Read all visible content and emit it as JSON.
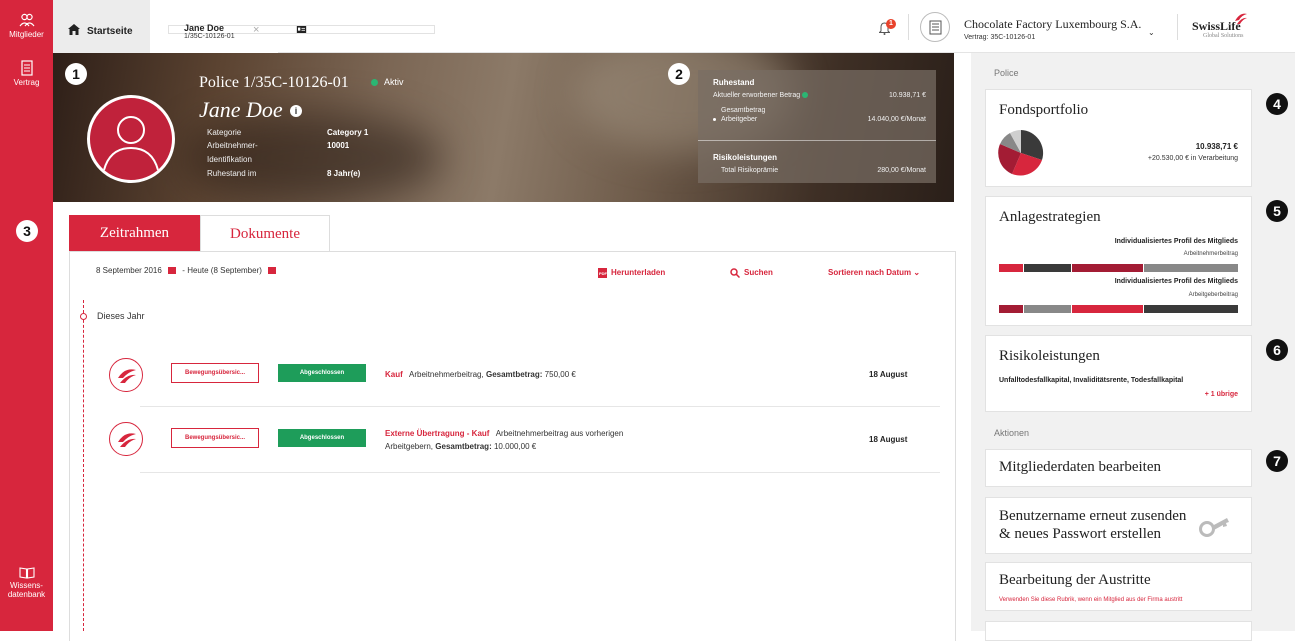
{
  "rail": {
    "members_label": "Mitglieder",
    "contract_label": "Vertrag",
    "knowledge_label_1": "Wissens-",
    "knowledge_label_2": "datenbank"
  },
  "topbar": {
    "home_tab": "Startseite",
    "user_tab_name": "Jane Doe",
    "user_tab_sub": "1/35C-10126-01",
    "close": "×",
    "notification_count": "1",
    "company": "Chocolate Factory Luxembourg S.A.",
    "contract": "Vertrag: 35C-10126-01",
    "brand": "SwissLife",
    "brand_sub": "Global Solutions"
  },
  "annotations": [
    "1",
    "2",
    "3",
    "4",
    "5",
    "6",
    "7"
  ],
  "hero": {
    "police": "Police 1/35C-10126-01",
    "status": "Aktiv",
    "name": "Jane Doe",
    "info": "i",
    "rows": [
      {
        "label": "Kategorie",
        "value": "Category 1"
      },
      {
        "label": "Arbeitnehmer-",
        "value": "10001"
      },
      {
        "label": "Identifikation",
        "value": ""
      },
      {
        "label": "Ruhestand im",
        "value": "8 Jahr(e)"
      }
    ],
    "summary": {
      "retirement_heading": "Ruhestand",
      "acquired_label": "Aktueller erworbener Betrag",
      "acquired_value": "10.938,71 €",
      "total_label": "Gesamtbetrag",
      "employer_label": "Arbeitgeber",
      "employer_value": "14.040,00 €/Monat",
      "risk_heading": "Risikoleistungen",
      "risk_label": "Total Risikoprämie",
      "risk_value": "280,00 €/Monat"
    }
  },
  "tabs": {
    "timeline": "Zeitrahmen",
    "documents": "Dokumente"
  },
  "toolbar": {
    "date_from": "8 September 2016",
    "date_sep": "-",
    "date_to": "Heute (8 September)",
    "download": "Herunterladen",
    "search": "Suchen",
    "sort": "Sortieren nach Datum"
  },
  "timeline": {
    "year": "Dieses Jahr",
    "entries": [
      {
        "button": "Bewegungsübersic...",
        "status": "Abgeschlossen",
        "kind": "Kauf",
        "text": "Arbeitnehmerbeitrag,",
        "total_label": "Gesamtbetrag:",
        "total_value": "750,00 €",
        "date": "18 August"
      },
      {
        "button": "Bewegungsübersic...",
        "status": "Abgeschlossen",
        "kind": "Externe Übertragung - Kauf",
        "text": "Arbeitnehmerbeitrag aus vorherigen",
        "text2": "Arbeitgebern,",
        "total_label": "Gesamtbetrag:",
        "total_value": "10.000,00 €",
        "date": "18 August"
      }
    ]
  },
  "right": {
    "police_section": "Police",
    "fund_title": "Fondsportfolio",
    "fund_value": "10.938,71 €",
    "fund_processing": "+20.530,00 € in Verarbeitung",
    "strategy_title": "Anlagestrategien",
    "strategy_profile_1": "Individualisiertes Profil des Mitglieds",
    "strategy_sub_1": "Arbeitnehmerbeitrag",
    "strategy_profile_2": "Individualisiertes Profil des Mitglieds",
    "strategy_sub_2": "Arbeitgeberbeitrag",
    "risk_title": "Risikoleistungen",
    "risk_list": "Unfalltodesfallkapital, Invaliditätsrente, Todesfallkapital",
    "risk_more": "+ 1 übrige",
    "actions_section": "Aktionen",
    "action_edit": "Mitgliederdaten bearbeiten",
    "action_resend_1": "Benutzername erneut zusenden",
    "action_resend_2": "& neues Passwort erstellen",
    "action_exit": "Bearbeitung der Austritte",
    "action_exit_sub": "Verwenden Sie diese Rubrik, wenn ein Mitglied aus der Firma austritt"
  },
  "colors": {
    "brand_red": "#d7263d",
    "green": "#1e9d5a",
    "dark_grey": "#3a3a3a",
    "mid_grey": "#888888",
    "dark_red": "#a31c34"
  }
}
